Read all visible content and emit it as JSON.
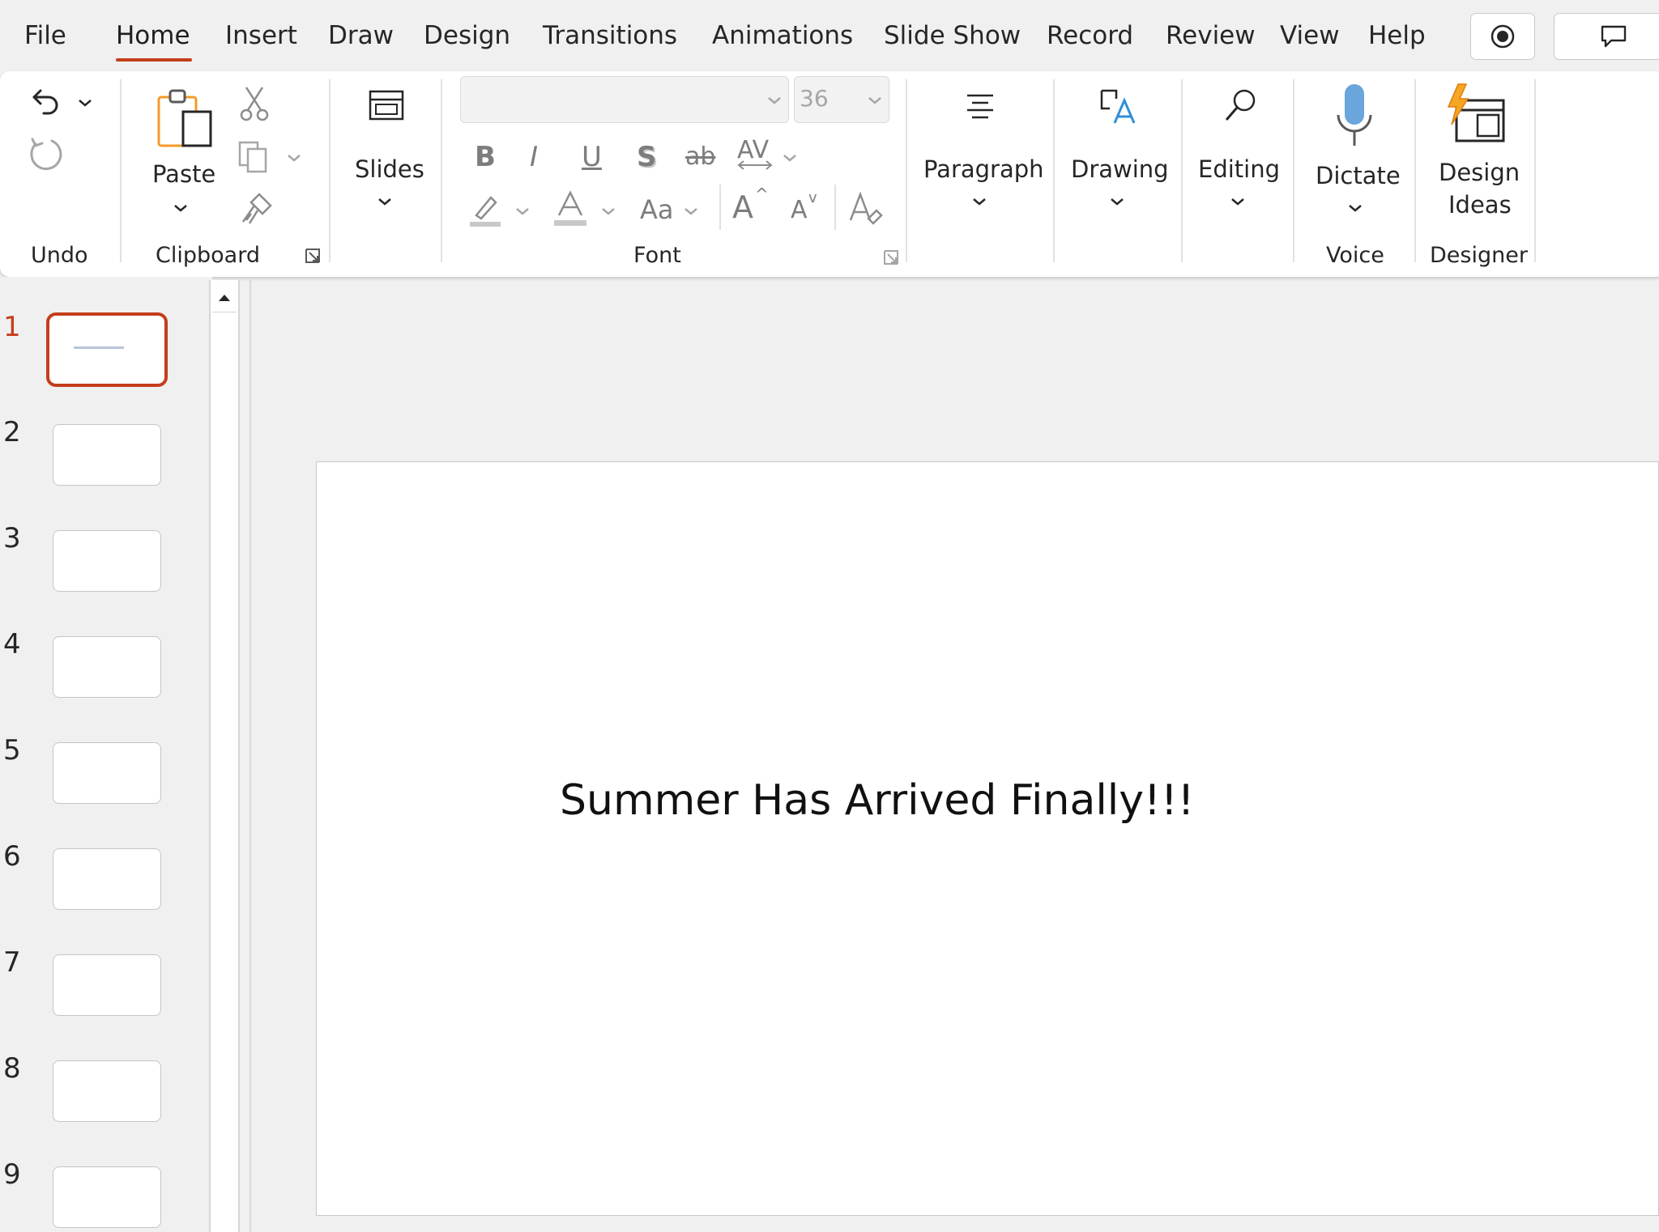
{
  "colors": {
    "accent": "#c43e1c",
    "dictate_blue": "#5b9bd5",
    "designer_orange": "#f5a623"
  },
  "menu": {
    "tabs": [
      {
        "label": "File"
      },
      {
        "label": "Home"
      },
      {
        "label": "Insert"
      },
      {
        "label": "Draw"
      },
      {
        "label": "Design"
      },
      {
        "label": "Transitions"
      },
      {
        "label": "Animations"
      },
      {
        "label": "Slide Show"
      },
      {
        "label": "Record"
      },
      {
        "label": "Review"
      },
      {
        "label": "View"
      },
      {
        "label": "Help"
      }
    ],
    "active_tab": "Home",
    "record_button_icon": "record-icon",
    "comments_button_icon": "comment-icon"
  },
  "ribbon": {
    "groups": {
      "undo": "Undo",
      "clipboard": "Clipboard",
      "font": "Font",
      "voice": "Voice",
      "designer": "Designer"
    },
    "buttons": {
      "paste": "Paste",
      "slides": "Slides",
      "paragraph": "Paragraph",
      "drawing": "Drawing",
      "editing": "Editing",
      "dictate": "Dictate",
      "design_ideas_line1": "Design",
      "design_ideas_line2": "Ideas"
    },
    "font": {
      "font_name_value": "",
      "font_size_value": "36",
      "bold": "B",
      "italic": "I",
      "underline": "U",
      "shadow": "S",
      "strikethrough": "ab",
      "spacing": "AV",
      "change_case": "Aa",
      "grow": "A",
      "shrink": "A"
    }
  },
  "slides": {
    "numbers": [
      "1",
      "2",
      "3",
      "4",
      "5",
      "6",
      "7",
      "8",
      "9"
    ],
    "selected": "1"
  },
  "slide": {
    "title": "Summer Has Arrived Finally!!!"
  }
}
